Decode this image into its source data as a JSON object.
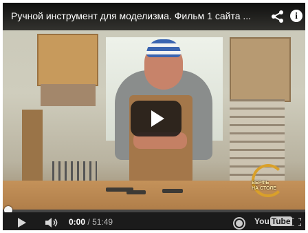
{
  "video": {
    "title": "Ручной инструмент для моделизма. Фильм 1 сайта ...",
    "channel_logo": {
      "line1": "ВЕРФЬ",
      "line2": "НА СТОЛЕ"
    }
  },
  "controls": {
    "current_time": "0:00",
    "separator": "/",
    "duration": "51:49",
    "progress_fraction": 0,
    "youtube_logo_you": "You",
    "youtube_logo_tube": "Tube"
  },
  "icons": {
    "share": "share-icon",
    "info": "info-icon",
    "big_play": "play-icon",
    "play": "play-icon",
    "volume": "volume-icon",
    "settings": "gear-icon",
    "fullscreen": "fullscreen-icon"
  },
  "info_glyph": "i",
  "colors": {
    "player_bg": "#000000",
    "control_bar": "#1b1b1b",
    "logo_gold": "#d9a02a"
  }
}
